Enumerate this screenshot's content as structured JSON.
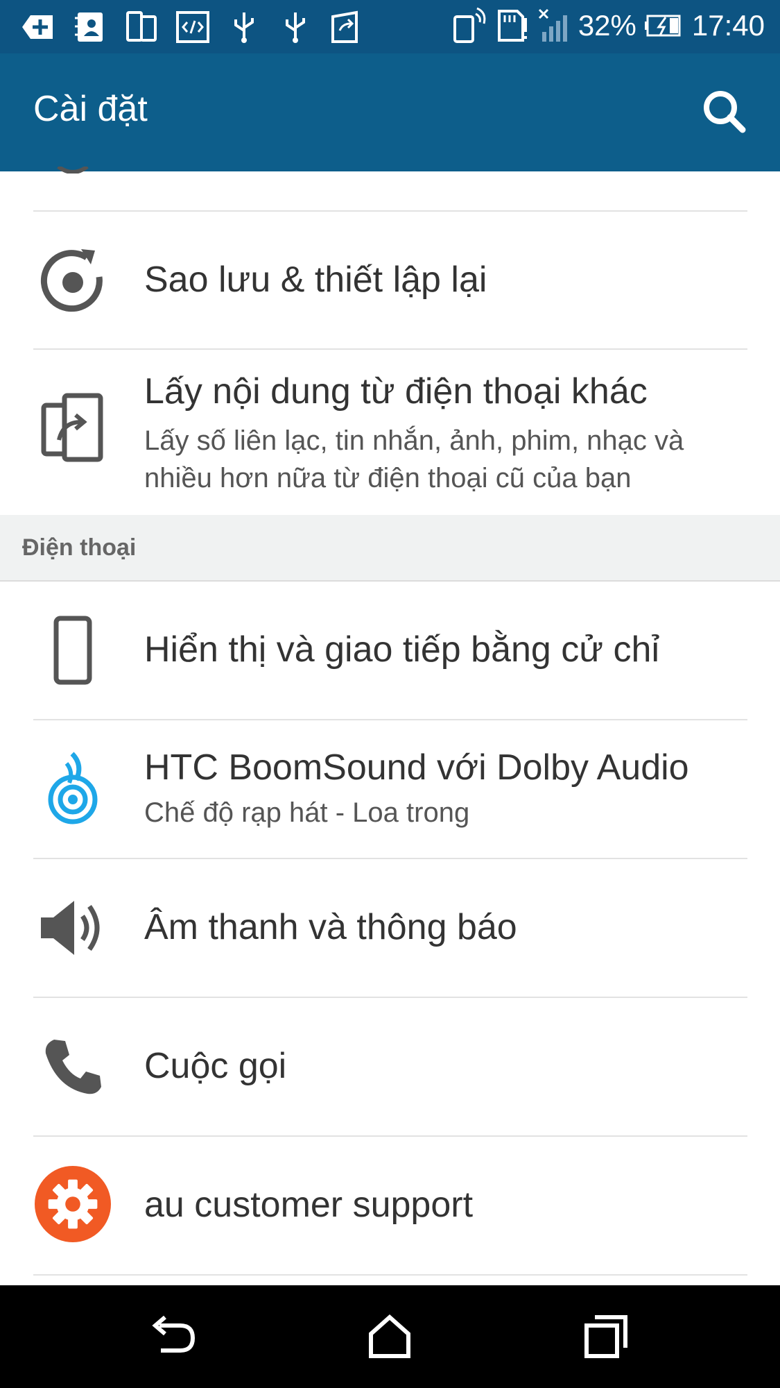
{
  "status_bar": {
    "icons_left": [
      "add-icon",
      "contacts-icon",
      "dual-sim-icon",
      "developer-icon",
      "usb-icon",
      "usb-icon",
      "transfer-icon"
    ],
    "battery_percent": "32%",
    "time": "17:40",
    "icons_right": [
      "nfc-phone-icon",
      "sd-card-icon",
      "signal-off-icon",
      "battery-charging-icon"
    ]
  },
  "app_bar": {
    "title": "Cài đặt",
    "search_icon": "search-icon"
  },
  "list": {
    "items": [
      {
        "title": "Sao lưu & thiết lập lại",
        "icon": "backup-reset-icon"
      },
      {
        "title": "Lấy nội dung từ điện thoại khác",
        "subtitle": "Lấy số liên lạc, tin nhắn, ảnh, phim, nhạc và nhiều hơn nữa từ điện thoại cũ của bạn",
        "icon": "transfer-content-icon"
      }
    ],
    "section_header": "Điện thoại",
    "phone_items": [
      {
        "title": "Hiển thị và giao tiếp bằng cử chỉ",
        "icon": "phone-display-icon"
      },
      {
        "title": "HTC BoomSound với Dolby Audio",
        "subtitle": "Chế độ rạp hát - Loa trong",
        "icon": "boomsound-icon"
      },
      {
        "title": "Âm thanh và thông báo",
        "icon": "speaker-icon"
      },
      {
        "title": "Cuộc gọi",
        "icon": "phone-call-icon"
      },
      {
        "title": "au customer support",
        "icon": "au-support-gear-icon"
      }
    ]
  },
  "colors": {
    "status_bar": "#0d5482",
    "app_bar": "#0d5e8b",
    "section_bg": "#f0f2f2",
    "boomsound_blue": "#1ea7e8",
    "au_orange": "#f15a24"
  },
  "nav_bar": {
    "buttons": [
      "back-icon",
      "home-icon",
      "recents-icon"
    ]
  }
}
